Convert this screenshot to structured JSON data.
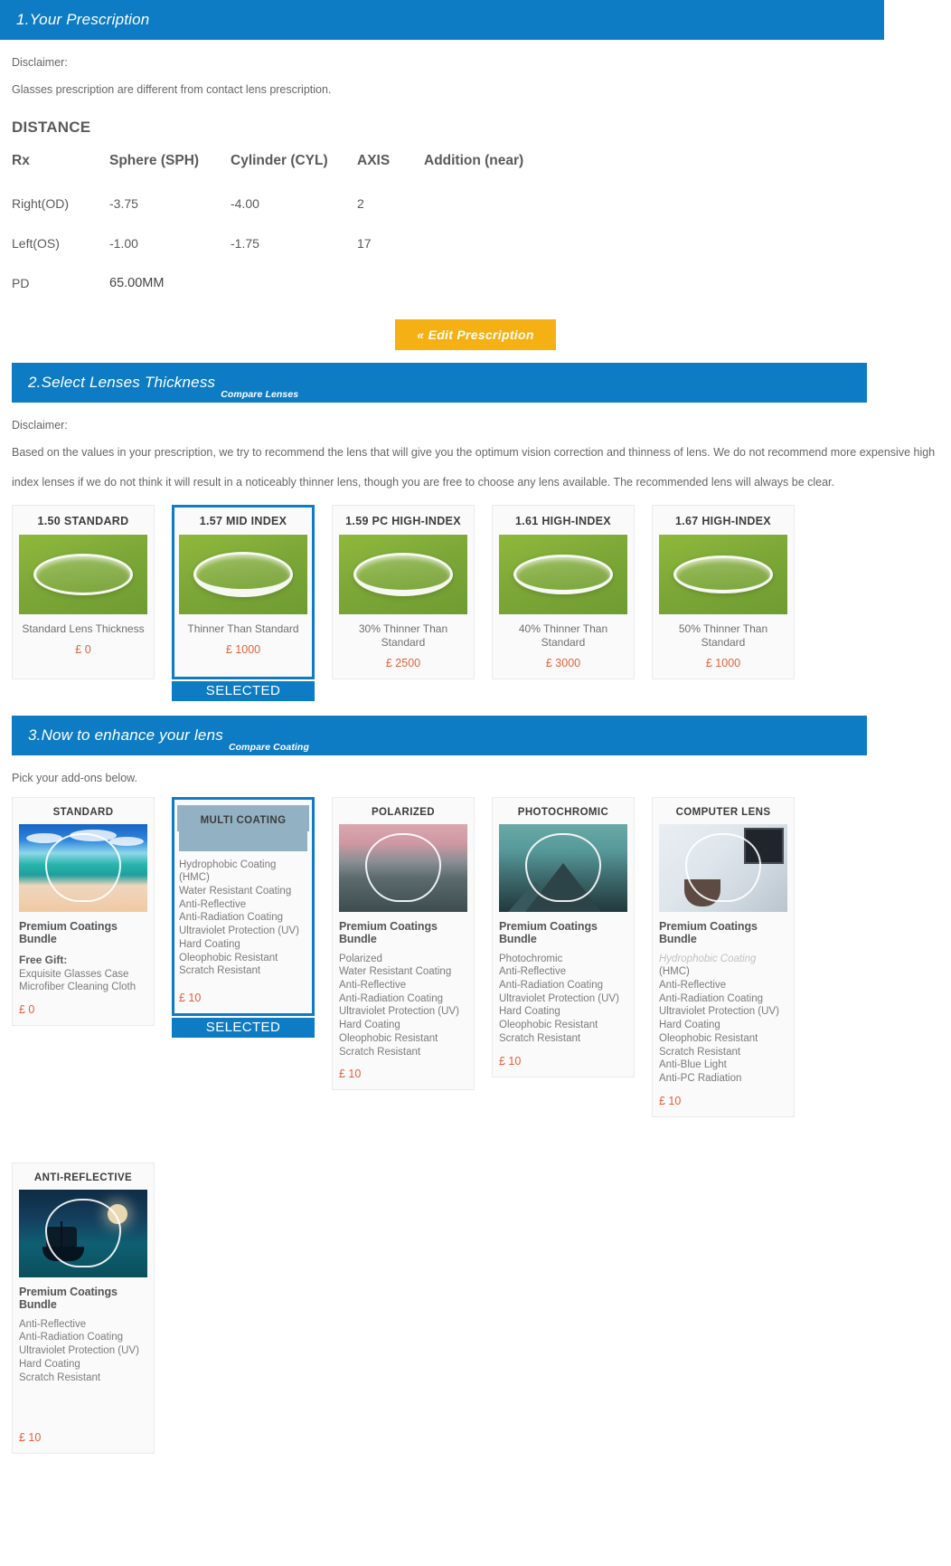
{
  "section1": {
    "header_title": "1.Your Prescription",
    "disclaimer_label": "Disclaimer:",
    "disclaimer_text": "Glasses prescription are different from contact lens prescription.",
    "distance_heading": "DISTANCE",
    "table": {
      "headers": [
        "Rx",
        "Sphere (SPH)",
        "Cylinder (CYL)",
        "AXIS",
        "Addition (near)"
      ],
      "rows": [
        {
          "rx": "Right(OD)",
          "sph": "-3.75",
          "cyl": "-4.00",
          "axis": "2",
          "add": ""
        },
        {
          "rx": "Left(OS)",
          "sph": "-1.00",
          "cyl": "-1.75",
          "axis": "17",
          "add": ""
        }
      ],
      "pd_label": "PD",
      "pd_value": "65.00MM"
    },
    "edit_button": "« Edit Prescription"
  },
  "section2": {
    "header_title": "2.Select Lenses Thickness",
    "header_link": "Compare Lenses",
    "disclaimer_label": "Disclaimer:",
    "disclaimer_line1": "Based on the values in your prescription, we try to recommend the lens that will give you the optimum vision correction and thinness of lens. We do not recommend more expensive high",
    "disclaimer_line2": "index lenses if we do not think it will result in a noticeably thinner lens, though you are free to choose any lens available. The recommended lens will always be clear.",
    "selected_banner": "SELECTED",
    "lenses": [
      {
        "title": "1.50 STANDARD",
        "desc": "Standard Lens Thickness",
        "price": "£ 0",
        "selected": false
      },
      {
        "title": "1.57 MID INDEX",
        "desc": "Thinner Than Standard",
        "price": "£ 1000",
        "selected": true
      },
      {
        "title": "1.59 PC HIGH-INDEX",
        "desc": "30% Thinner Than Standard",
        "price": "£ 2500",
        "selected": false
      },
      {
        "title": "1.61 HIGH-INDEX",
        "desc": "40% Thinner Than Standard",
        "price": "£ 3000",
        "selected": false
      },
      {
        "title": "1.67 HIGH-INDEX",
        "desc": "50% Thinner Than Standard",
        "price": "£ 1000",
        "selected": false
      }
    ]
  },
  "section3": {
    "header_title": "3.Now to enhance your lens",
    "header_link": "Compare Coating",
    "pick_text": "Pick your add-ons below.",
    "selected_banner": "SELECTED",
    "bundle_label": "Premium Coatings Bundle",
    "coatings": [
      {
        "title": "STANDARD",
        "bundle": "Premium Coatings Bundle",
        "gift_label": "Free Gift:",
        "gift_items": "Exquisite Glasses Case\nMicrofiber Cleaning Cloth",
        "features": "",
        "price": "£ 0",
        "selected": false,
        "image": "beach-lens-image"
      },
      {
        "title": "MULTI COATING",
        "bundle": "",
        "gift_label": "",
        "gift_items": "",
        "features": "Hydrophobic Coating (HMC)\nWater Resistant Coating\nAnti-Reflective\nAnti-Radiation Coating\nUltraviolet Protection (UV)\nHard Coating\nOleophobic Resistant\nScratch Resistant",
        "price": "£ 10",
        "selected": true,
        "image": "multi-coating-swatch-image"
      },
      {
        "title": "POLARIZED",
        "bundle": "Premium Coatings Bundle",
        "gift_label": "",
        "gift_items": "",
        "features": "Polarized\nWater Resistant Coating\nAnti-Reflective\nAnti-Radiation Coating\nUltraviolet Protection (UV)\nHard Coating\nOleophobic Resistant\nScratch Resistant",
        "price": "£ 10",
        "selected": false,
        "image": "polarized-mountain-lens-image"
      },
      {
        "title": "PHOTOCHROMIC",
        "bundle": "Premium Coatings Bundle",
        "gift_label": "",
        "gift_items": "",
        "features": "Photochromic\nAnti-Reflective\nAnti-Radiation Coating\nUltraviolet Protection (UV)\nHard Coating\nOleophobic Resistant\nScratch Resistant",
        "price": "£ 10",
        "selected": false,
        "image": "photochromic-mountain-lens-image"
      },
      {
        "title": "COMPUTER LENS",
        "bundle": "Premium Coatings Bundle",
        "gift_label": "",
        "gift_items": "",
        "features_faded": "Hydrophobic Coating",
        "features": "(HMC)\nAnti-Reflective\nAnti-Radiation Coating\nUltraviolet Protection (UV)\nHard Coating\nOleophobic Resistant\nScratch Resistant\nAnti-Blue Light\nAnti-PC Radiation",
        "price": "£ 10",
        "selected": false,
        "image": "computer-desk-lens-image"
      },
      {
        "title": "ANTI-REFLECTIVE",
        "bundle": "Premium Coatings Bundle",
        "gift_label": "",
        "gift_items": "",
        "features": "Anti-Reflective\nAnti-Radiation Coating\nUltraviolet Protection (UV)\nHard Coating\nScratch Resistant",
        "price": "£ 10",
        "selected": false,
        "image": "night-ship-lens-image"
      }
    ]
  },
  "colors": {
    "section_bar": "#0d7cc4",
    "accent_button": "#f5b014",
    "price": "#e2613b",
    "selected_border": "#0d7cc4"
  }
}
